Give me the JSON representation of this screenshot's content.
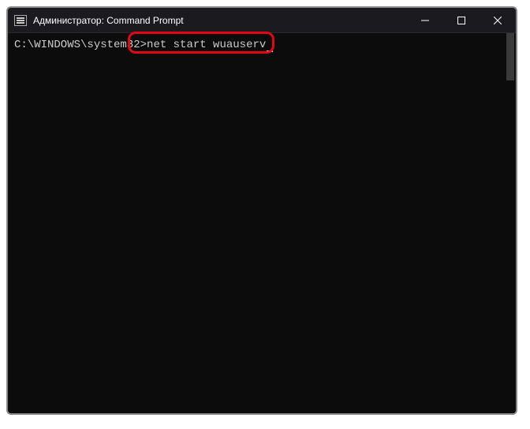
{
  "window": {
    "title": "Администратор: Command Prompt"
  },
  "terminal": {
    "prompt_path": "C:\\WINDOWS\\system32",
    "prompt_char": ">",
    "command": "net start wuauserv"
  }
}
